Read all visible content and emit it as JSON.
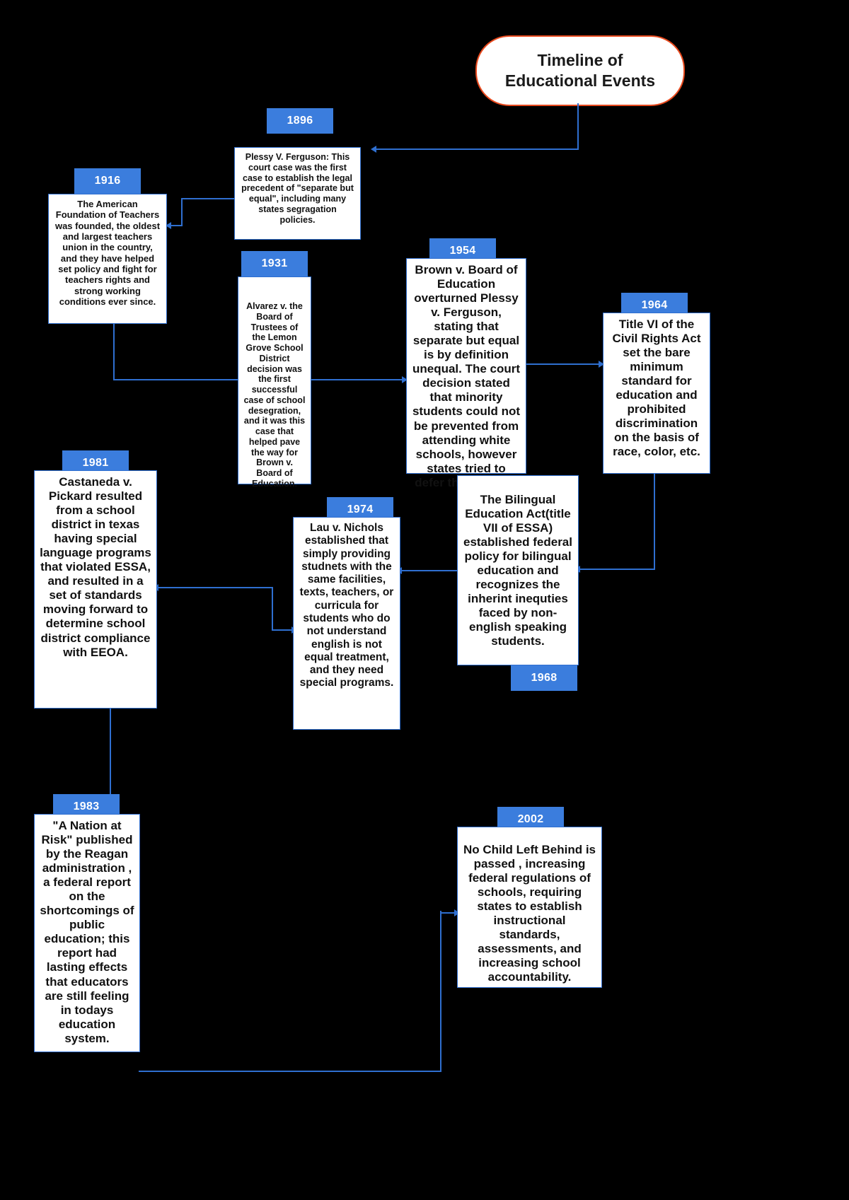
{
  "title": {
    "line1": "Timeline of",
    "line2": "Educational Events"
  },
  "colors": {
    "background": "#000000",
    "box_border": "#2f6fd0",
    "box_fill": "#ffffff",
    "year_chip": "#3b7ddd",
    "year_text": "#ffffff",
    "title_border": "#e8491d",
    "connector": "#2f6fd0",
    "text": "#111111"
  },
  "events": [
    {
      "year": "1896",
      "text": "Plessy V. Ferguson: This court case was the first case to establish the legal precedent of \"separate but equal\", including many states segragation policies."
    },
    {
      "year": "1916",
      "text": "The American Foundation of Teachers was founded, the oldest and largest teachers union in the country, and they have helped set policy and fight for teachers rights and strong working conditions ever since."
    },
    {
      "year": "1931",
      "text": "Alvarez v. the Board of Trustees of the Lemon Grove School District decision was the first successful case of school desegration, and it was this case that helped pave the way for Brown v. Board of Education."
    },
    {
      "year": "1954",
      "text": "Brown v. Board of Education overturned Plessy v. Ferguson, stating that separate but equal is by definition unequal. The court decision stated that minority students could not be prevented from attending white schools, however states tried to defer this change."
    },
    {
      "year": "1964",
      "text": "Title VI of the Civil Rights Act set the bare minimum standard for education and prohibited discrimination on the basis of race, color, etc."
    },
    {
      "year": "1968",
      "text": "The Bilingual Education Act(title VII of ESSA) established federal policy for bilingual education and recognizes the inherint inequties faced by non-english speaking students."
    },
    {
      "year": "1974",
      "text": "Lau v. Nichols established that simply providing studnets with the same facilities, texts, teachers, or curricula for students who do not understand english is not equal treatment, and they need special programs."
    },
    {
      "year": "1981",
      "text": "Castaneda v. Pickard resulted from a school district in texas having special language programs that violated ESSA, and resulted in a set of standards moving forward to determine school district compliance with EEOA."
    },
    {
      "year": "1983",
      "text": "\"A Nation at Risk\" published by the Reagan administration , a federal report on the shortcomings of public education; this report had lasting effects that educators are still feeling in todays education system."
    },
    {
      "year": "2002",
      "text": "No Child Left Behind is passed , increasing federal regulations of schools, requiring states to establish instructional standards, assessments, and increasing school accountability."
    }
  ]
}
